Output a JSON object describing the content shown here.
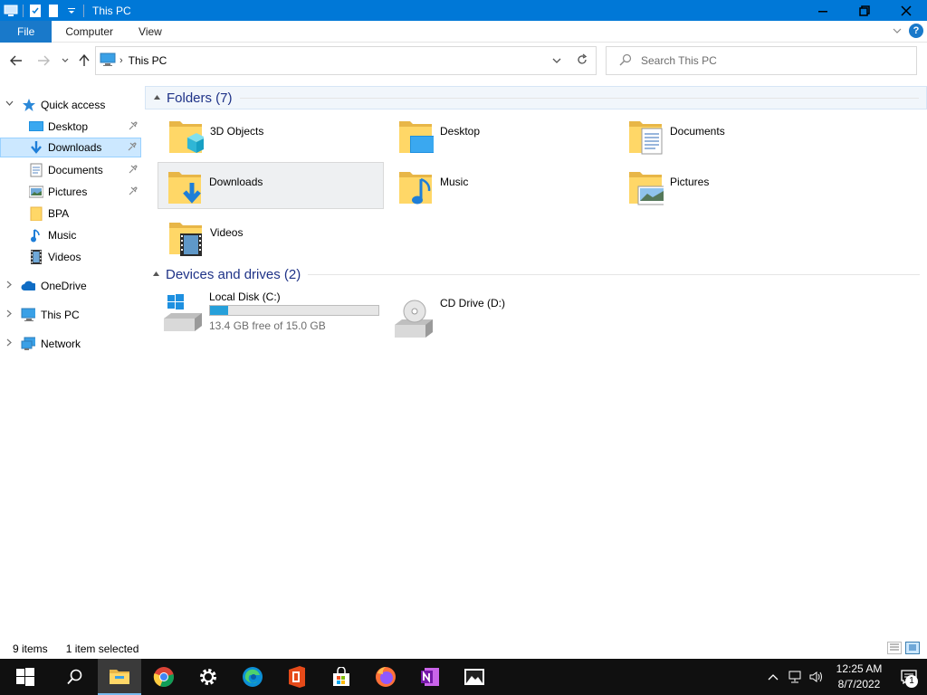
{
  "window": {
    "title": "This PC",
    "buttons": {
      "minimize": "—",
      "maximize": "❐",
      "close": "✕"
    }
  },
  "ribbon": {
    "tabs": [
      "File",
      "Computer",
      "View"
    ]
  },
  "address": {
    "path": "This PC",
    "search_placeholder": "Search This PC"
  },
  "nav_pane": {
    "quick_access": "Quick access",
    "quick_items": [
      {
        "label": "Desktop",
        "icon": "desktop-icon",
        "pinned": true
      },
      {
        "label": "Downloads",
        "icon": "downloads-icon",
        "pinned": true,
        "selected": true
      },
      {
        "label": "Documents",
        "icon": "documents-icon",
        "pinned": true
      },
      {
        "label": "Pictures",
        "icon": "pictures-icon",
        "pinned": true
      },
      {
        "label": "BPA",
        "icon": "folder-icon",
        "pinned": false
      },
      {
        "label": "Music",
        "icon": "music-icon",
        "pinned": false
      },
      {
        "label": "Videos",
        "icon": "videos-icon",
        "pinned": false
      }
    ],
    "onedrive": "OneDrive",
    "this_pc": "This PC",
    "network": "Network"
  },
  "content": {
    "folders_header": "Folders (7)",
    "folders": [
      {
        "label": "3D Objects",
        "overlay": "cube"
      },
      {
        "label": "Desktop",
        "overlay": "desktop"
      },
      {
        "label": "Documents",
        "overlay": "document"
      },
      {
        "label": "Downloads",
        "overlay": "download"
      },
      {
        "label": "Music",
        "overlay": "music"
      },
      {
        "label": "Pictures",
        "overlay": "picture"
      },
      {
        "label": "Videos",
        "overlay": "film"
      }
    ],
    "drives_header": "Devices and drives (2)",
    "drives": [
      {
        "label": "Local Disk (C:)",
        "free_text": "13.4 GB free of 15.0 GB",
        "used_fraction": 0.107
      },
      {
        "label": "CD Drive (D:)"
      }
    ]
  },
  "status": {
    "item_count": "9 items",
    "selected": "1 item selected"
  },
  "taskbar": {
    "apps": [
      "start-icon",
      "search-icon",
      "file-explorer-icon",
      "chrome-icon",
      "settings-icon",
      "edge-icon",
      "office-icon",
      "store-icon",
      "firefox-icon",
      "onenote-icon",
      "photos-icon"
    ],
    "time": "12:25 AM",
    "date": "8/7/2022",
    "notification_count": "1"
  },
  "colors": {
    "titlebar": "#0078d7",
    "accent": "#1979ca",
    "selection": "#cce8ff",
    "drive_fill": "#26a0da",
    "group_header_text": "#1e3287"
  }
}
